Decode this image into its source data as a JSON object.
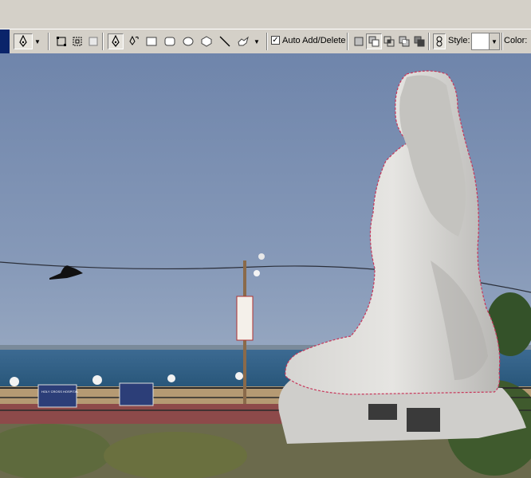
{
  "toolbar": {
    "auto_add_delete_label": "Auto Add/Delete",
    "auto_add_delete_checked": true,
    "style_label": "Style:",
    "color_label": "Color:",
    "tools": [
      "pen-tool-icon",
      "freeform-pen-icon",
      "rectangle-icon",
      "rounded-rectangle-icon",
      "ellipse-icon",
      "polygon-icon",
      "line-icon",
      "custom-shape-icon"
    ]
  },
  "canvas": {
    "description_colors": {
      "sky": "#7f93b4",
      "sea": "#2e5d86",
      "statue": "#dcdbd8",
      "path": "#c8365a"
    },
    "sign_text": "HOLY CROSS HOSPITAL"
  }
}
